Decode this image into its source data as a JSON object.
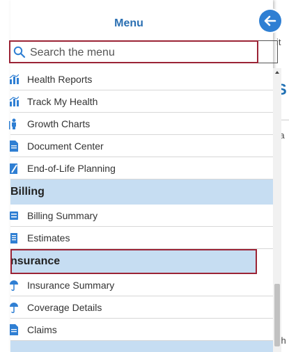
{
  "header": {
    "title": "Menu"
  },
  "search": {
    "placeholder": "Search the menu",
    "value": ""
  },
  "background": {
    "frag1": "it",
    "frag2": "S",
    "frag3": "ra",
    "frag4": "ch"
  },
  "items_top": [
    {
      "label": "Health Reports",
      "icon": "bar-chart-icon"
    },
    {
      "label": "Track My Health",
      "icon": "bar-chart-icon"
    },
    {
      "label": "Growth Charts",
      "icon": "growth-person-icon"
    },
    {
      "label": "Document Center",
      "icon": "document-icon"
    },
    {
      "label": "End-of-Life Planning",
      "icon": "pen-document-icon"
    }
  ],
  "sections": {
    "billing": {
      "title": "Billing",
      "items": [
        {
          "label": "Billing Summary",
          "icon": "billing-icon"
        },
        {
          "label": "Estimates",
          "icon": "estimate-icon"
        }
      ]
    },
    "insurance": {
      "title": "nsurance",
      "items": [
        {
          "label": "Insurance Summary",
          "icon": "umbrella-icon"
        },
        {
          "label": "Coverage Details",
          "icon": "umbrella-icon"
        },
        {
          "label": "Claims",
          "icon": "document-icon"
        }
      ]
    }
  },
  "colors": {
    "accent": "#2f7fd3",
    "section_bg": "#c6ddf2",
    "focus": "#9b2335"
  }
}
